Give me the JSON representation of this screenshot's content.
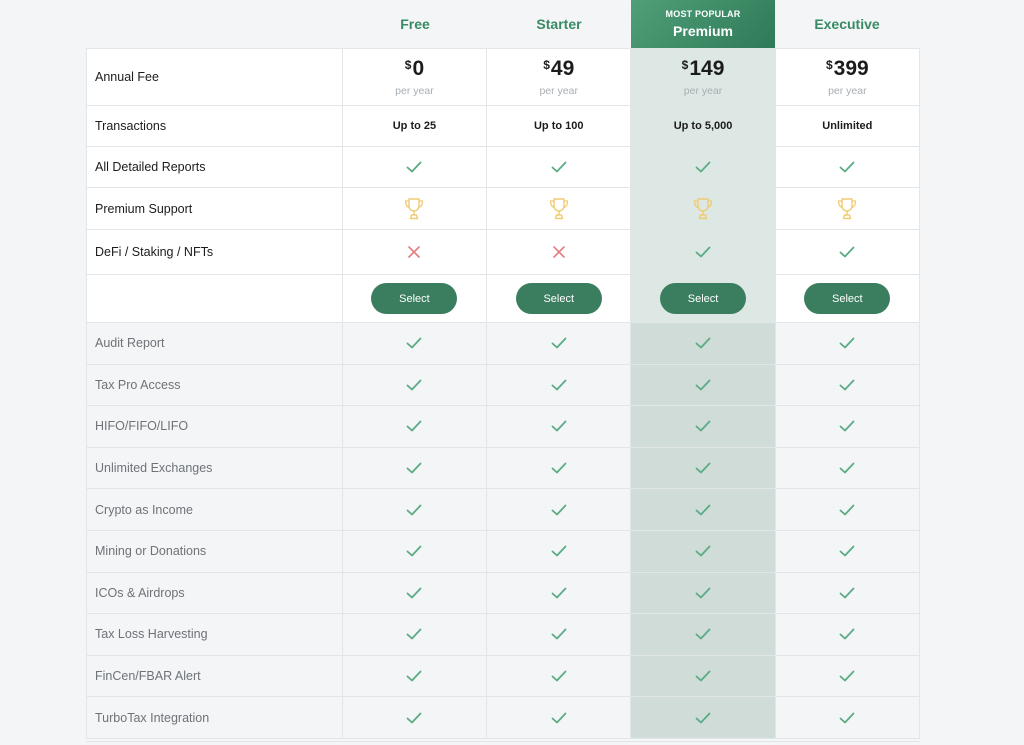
{
  "colors": {
    "accent": "#3a8a64",
    "button": "#3b7e5f",
    "check": "#5bab86",
    "cross": "#e27c7c",
    "trophy": "#f0cb73",
    "popular_bg": "#dde8e5"
  },
  "plans": [
    {
      "name": "Free"
    },
    {
      "name": "Starter"
    },
    {
      "tag": "MOST POPULAR",
      "name": "Premium"
    },
    {
      "name": "Executive"
    }
  ],
  "annual_fee": {
    "label": "Annual Fee",
    "currency": "$",
    "per": "per year",
    "values": [
      "0",
      "49",
      "149",
      "399"
    ]
  },
  "transactions": {
    "label": "Transactions",
    "values": [
      "Up to 25",
      "Up to 100",
      "Up to 5,000",
      "Unlimited"
    ]
  },
  "top_features": [
    {
      "label": "All Detailed Reports",
      "values": [
        "check",
        "check",
        "check",
        "check"
      ]
    },
    {
      "label": "Premium Support",
      "values": [
        "trophy",
        "trophy",
        "trophy",
        "trophy"
      ]
    },
    {
      "label": "DeFi / Staking / NFTs",
      "values": [
        "cross",
        "cross",
        "check",
        "check"
      ]
    }
  ],
  "select_label": "Select",
  "bottom_features": [
    {
      "label": "Audit Report",
      "values": [
        "check",
        "check",
        "check",
        "check"
      ]
    },
    {
      "label": "Tax Pro Access",
      "values": [
        "check",
        "check",
        "check",
        "check"
      ]
    },
    {
      "label": "HIFO/FIFO/LIFO",
      "values": [
        "check",
        "check",
        "check",
        "check"
      ]
    },
    {
      "label": "Unlimited Exchanges",
      "values": [
        "check",
        "check",
        "check",
        "check"
      ]
    },
    {
      "label": "Crypto as Income",
      "values": [
        "check",
        "check",
        "check",
        "check"
      ]
    },
    {
      "label": "Mining or Donations",
      "values": [
        "check",
        "check",
        "check",
        "check"
      ]
    },
    {
      "label": "ICOs & Airdrops",
      "values": [
        "check",
        "check",
        "check",
        "check"
      ]
    },
    {
      "label": "Tax Loss Harvesting",
      "values": [
        "check",
        "check",
        "check",
        "check"
      ]
    },
    {
      "label": "FinCen/FBAR Alert",
      "values": [
        "check",
        "check",
        "check",
        "check"
      ]
    },
    {
      "label": "TurboTax Integration",
      "values": [
        "check",
        "check",
        "check",
        "check"
      ]
    }
  ]
}
